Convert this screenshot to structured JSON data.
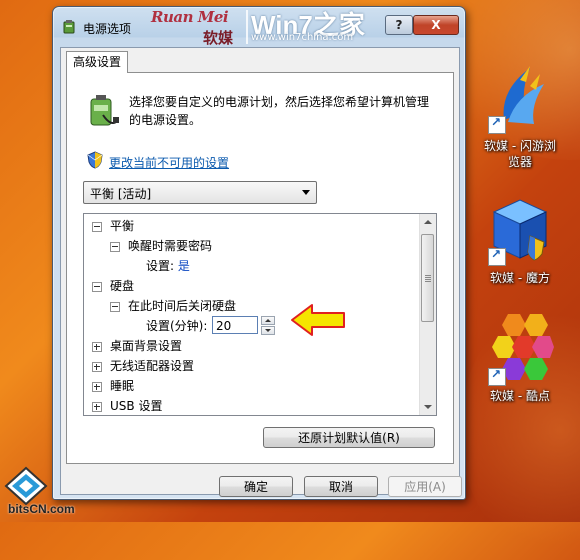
{
  "window": {
    "title": "电源选项",
    "watermark_brand": "Ruan Mei",
    "watermark_cn": "软媒",
    "watermark_site": "Win7之家",
    "watermark_url": "www.win7china.com",
    "help_label": "?",
    "close_label": "X"
  },
  "tab": {
    "label": "高级设置"
  },
  "description": "选择您要自定义的电源计划，然后选择您希望计算机管理的电源设置。",
  "link": {
    "label": "更改当前不可用的设置"
  },
  "plan_select": {
    "value": "平衡 [活动]"
  },
  "tree": {
    "row0": "平衡",
    "row1": "唤醒时需要密码",
    "row2_label": "设置:",
    "row2_value": "是",
    "row3": "硬盘",
    "row4": "在此时间后关闭硬盘",
    "row5_label": "设置(分钟):",
    "row5_value": "20",
    "row6": "桌面背景设置",
    "row7": "无线适配器设置",
    "row8": "睡眠",
    "row9": "USB 设置"
  },
  "buttons": {
    "restore": "还原计划默认值(R)",
    "ok": "确定",
    "cancel": "取消",
    "apply": "应用(A)"
  },
  "desktop": {
    "icon1_label_l1": "软媒 - 闪游浏",
    "icon1_label_l2": "览器",
    "icon2_label": "软媒 - 魔方",
    "icon3_label": "软媒 - 酷点",
    "site_logo": "bitsCN.com"
  },
  "colors": {
    "link": "#0b5aae",
    "annotation_arrow": "#f5e400",
    "annotation_outline": "#e02020"
  }
}
